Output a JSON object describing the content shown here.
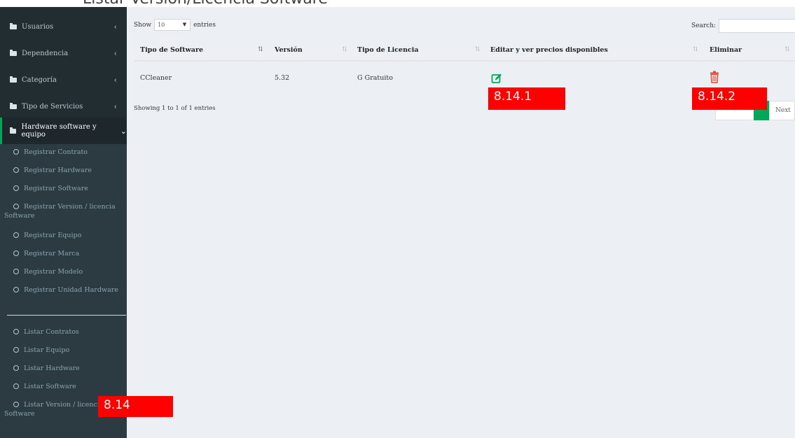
{
  "page_heading": "Listar Version/Licencia Software",
  "sidebar": {
    "menu": [
      {
        "label": "Usuarios",
        "chevron": "‹"
      },
      {
        "label": "Dependencia",
        "chevron": "‹"
      },
      {
        "label": "Categoría",
        "chevron": "‹"
      },
      {
        "label": "Tipo de Servicios",
        "chevron": "‹"
      },
      {
        "label": "Hardware software y equipo",
        "chevron": "⌄"
      }
    ],
    "register_items": [
      "Registrar Contrato",
      "Registrar Hardware",
      "Registrar Software",
      "Registrar Version / licencia",
      "Software",
      "Registrar Equipo",
      "Registrar Marca",
      "Registrar Modelo",
      "Registrar Unidad Hardware"
    ],
    "list_items": [
      "Listar Contratos",
      "Listar Equipo",
      "Listar Hardware",
      "Listar Software",
      "Listar Version / licencia",
      "Software"
    ]
  },
  "table_controls": {
    "show_label": "Show",
    "entries_value": "10",
    "select_arrow": "▼",
    "entries_label": "entries",
    "search_label": "Search:"
  },
  "table": {
    "columns": [
      "Tipo de Software",
      "Versión",
      "Tipo de Licencia",
      "Editar y ver precios disponibles",
      "Eliminar"
    ],
    "rows": [
      {
        "tipo_software": "CCleaner",
        "version": "5.32",
        "tipo_licencia": "G Gratuito"
      }
    ]
  },
  "footer": {
    "info": "Showing 1 to 1 of 1 entries",
    "next_label": "Next"
  },
  "icons": {
    "edit": "edit-icon",
    "delete": "trash-icon"
  },
  "callouts": {
    "edit": "8.14.1",
    "delete": "8.14.2",
    "list_version": "8.14"
  },
  "colors": {
    "sidebar_bg": "#222d32",
    "submenu_bg": "#2c3b41",
    "active_accent": "#00a65a",
    "content_bg": "#ecf0f5",
    "edit_icon": "#00a65a",
    "delete_icon": "#dd4b39",
    "callout_bg": "#ff0000"
  }
}
